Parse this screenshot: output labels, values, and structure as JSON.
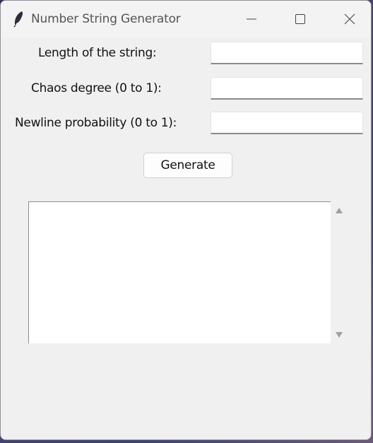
{
  "window": {
    "title": "Number String Generator",
    "controls": {
      "minimize": "minimize-icon",
      "maximize": "maximize-icon",
      "close": "close-icon"
    }
  },
  "form": {
    "length_label": "Length of the string:",
    "length_value": "",
    "chaos_label": "Chaos degree (0 to 1):",
    "chaos_value": "",
    "newline_label": "Newline probability (0 to 1):",
    "newline_value": ""
  },
  "actions": {
    "generate_label": "Generate"
  },
  "output": {
    "text": ""
  },
  "colors": {
    "window_bg": "#f0f0f0",
    "input_bg": "#ffffff",
    "scroll_arrow": "#a0a0a0"
  }
}
